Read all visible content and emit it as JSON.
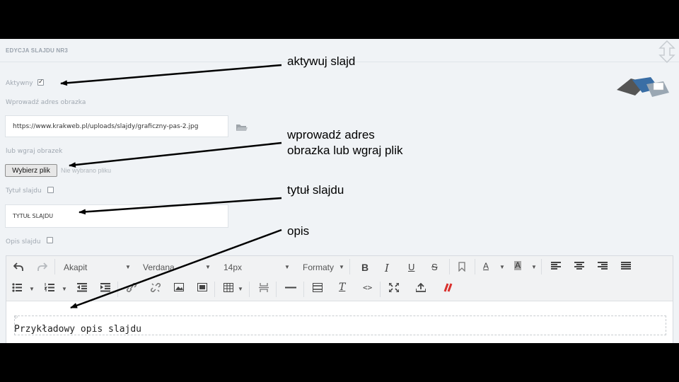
{
  "header": {
    "title": "EDYCJA SLAJDU NR3"
  },
  "form": {
    "active_label": "Aktywny",
    "image_url_label": "Wprowadź adres obrazka",
    "image_url_value": "https://www.krakweb.pl/uploads/slajdy/graficzny-pas-2.jpg",
    "upload_label": "lub wgraj obrazek",
    "choose_file_label": "Wybierz plik",
    "no_file_text": "Nie wybrano pliku",
    "title_label": "Tytuł slajdu",
    "title_value": "TYTUŁ SLAJDU",
    "desc_label": "Opis slajdu"
  },
  "editor": {
    "format_block": "Akapit",
    "font_family": "Verdana",
    "font_size": "14px",
    "formats_label": "Formaty",
    "bold": "B",
    "italic": "I",
    "underline": "U",
    "strike": "S",
    "font_color": "A",
    "bg_color": "A",
    "clear_format": "T",
    "code": "<>",
    "paragraph_marker": "P",
    "content": "Przykładowy opis slajdu"
  },
  "annotations": {
    "activate": "aktywuj slajd",
    "address_line1": "wprowadź adres",
    "address_line2": "obrazka lub wgraj plik",
    "title": "tytuł slajdu",
    "desc": "opis"
  },
  "colors": {
    "accent_red": "#d9302c"
  }
}
